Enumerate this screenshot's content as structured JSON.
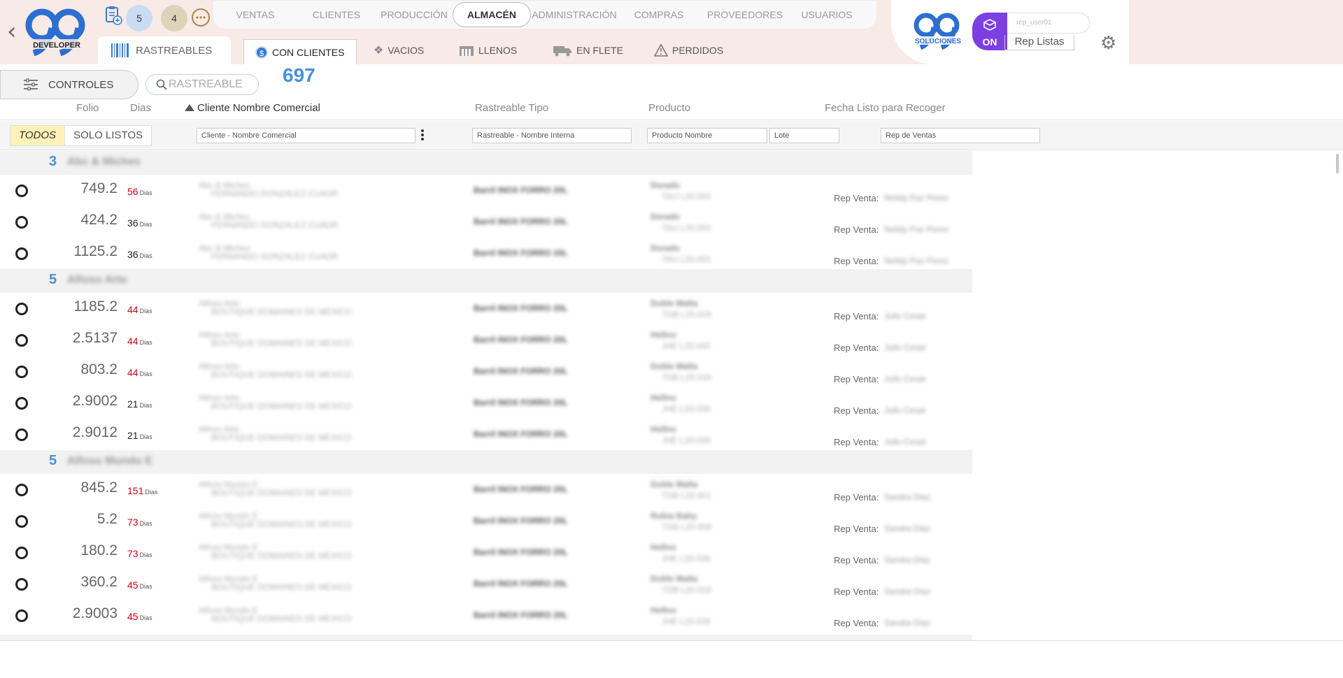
{
  "header": {
    "back_icon": "chevron-left-icon",
    "logo_left": {
      "main": "99",
      "caption": "DEVELOPER"
    },
    "badges": [
      {
        "value": "5",
        "color": "#c9dcf2"
      },
      {
        "value": "4",
        "color": "#ddd3b8"
      }
    ],
    "nav": [
      {
        "label": "VENTAS",
        "active": false
      },
      {
        "label": "CLIENTES",
        "active": false
      },
      {
        "label": "PRODUCCIÓN",
        "active": false
      },
      {
        "label": "ALMACÉN",
        "active": true
      },
      {
        "label": "ADMINISTRACIÓN",
        "active": false
      },
      {
        "label": "COMPRAS",
        "active": false
      },
      {
        "label": "PROVEEDORES",
        "active": false
      },
      {
        "label": "USUARIOS",
        "active": false
      }
    ],
    "logo_right": {
      "main": "99",
      "caption": "SOLUCIONES"
    },
    "on_label": "ON",
    "rep_input_value": "rep_user01",
    "rep_listas_label": "Rep Listas"
  },
  "subtabs": {
    "rastreables": "RASTREABLES",
    "con_clientes": "CON CLIENTES",
    "vacios": "VACIOS",
    "llenos": "LLENOS",
    "en_flete": "EN FLETE",
    "perdidos": "PERDIDOS"
  },
  "controls": {
    "controles_label": "CONTROLES",
    "search_placeholder": "RASTREABLE",
    "count": "697"
  },
  "columns": {
    "folio": "Folio",
    "dias": "Dias",
    "cliente": "Cliente Nombre Comercial",
    "tipo": "Rastreable Tipo",
    "producto": "Producto",
    "fecha": "Fecha Listo para Recoger"
  },
  "filters": {
    "todos": "TODOS",
    "solo_listos": "SOLO LISTOS",
    "cliente_placeholder": "Cliente - Nombre Comercial",
    "rastreable_placeholder": "Rastreable - Nombre Interna",
    "producto_placeholder": "Producto Nombre",
    "lote_placeholder": "Lote",
    "rep_placeholder": "Rep de Ventas"
  },
  "rep_label": "Rep Venta:",
  "dias_unit": "Dias",
  "groups": [
    {
      "count": "3",
      "name": "Abc & Miches",
      "rows": [
        {
          "folio": "749.2",
          "dias": "56",
          "red": true,
          "c1": "Abc & Miches",
          "c2": "FERNANDO GONZALEZ CUADR",
          "tipo": "Barril INOX FORRO 20L",
          "p1": "Dorado",
          "p2": "TAU L20.003",
          "rep": "Nelidy Paz Perez"
        },
        {
          "folio": "424.2",
          "dias": "36",
          "red": false,
          "c1": "Abc & Miches",
          "c2": "FERNANDO GONZALEZ CUADR",
          "tipo": "Barril INOX FORRO 20L",
          "p1": "Dorado",
          "p2": "TAU L20.003",
          "rep": "Nelidy Paz Perez"
        },
        {
          "folio": "1125.2",
          "dias": "36",
          "red": false,
          "c1": "Abc & Miches",
          "c2": "FERNANDO GONZALEZ CUADR",
          "tipo": "Barril INOX FORRO 20L",
          "p1": "Dorado",
          "p2": "TAU L20.003",
          "rep": "Nelidy Paz Perez"
        }
      ]
    },
    {
      "count": "5",
      "name": "Alfoso Arte",
      "rows": [
        {
          "folio": "1185.2",
          "dias": "44",
          "red": true,
          "c1": "Alfoso Arte",
          "c2": "BOUTIQUE DOMAINES DE MEXICO",
          "tipo": "Barril INOX FORRO 20L",
          "p1": "Doble Malta",
          "p2": "TDB L20.018",
          "rep": "Julio Cesar"
        },
        {
          "folio": "2.5137",
          "dias": "44",
          "red": true,
          "c1": "Alfoso Arte",
          "c2": "BOUTIQUE DOMAINES DE MEXICO",
          "tipo": "Barril INOX FORRO 20L",
          "p1": "Hellno",
          "p2": "JHE L20.045",
          "rep": "Julio Cesar"
        },
        {
          "folio": "803.2",
          "dias": "44",
          "red": true,
          "c1": "Alfoso Arte",
          "c2": "BOUTIQUE DOMAINES DE MEXICO",
          "tipo": "Barril INOX FORRO 20L",
          "p1": "Doble Malta",
          "p2": "TDB L20.018",
          "rep": "Julio Cesar"
        },
        {
          "folio": "2.9002",
          "dias": "21",
          "red": false,
          "c1": "Alfoso Arte",
          "c2": "BOUTIQUE DOMAINES DE MEXICO",
          "tipo": "Barril INOX FORRO 20L",
          "p1": "Hellno",
          "p2": "JHE L20.039",
          "rep": "Julio Cesar"
        },
        {
          "folio": "2.9012",
          "dias": "21",
          "red": false,
          "c1": "Alfoso Arte",
          "c2": "BOUTIQUE DOMAINES DE MEXICO",
          "tipo": "Barril INOX FORRO 20L",
          "p1": "Hellno",
          "p2": "JHE L20.039",
          "rep": "Julio Cesar"
        }
      ]
    },
    {
      "count": "5",
      "name": "Alfoso Mundo E",
      "rows": [
        {
          "folio": "845.2",
          "dias": "151",
          "red": true,
          "c1": "Alfoso Mundo E",
          "c2": "BOUTIQUE DOMAINES DE MEXICO",
          "tipo": "Barril INOX FORRO 20L",
          "p1": "Doble Malta",
          "p2": "TDB L20.001",
          "rep": "Sandra Diaz"
        },
        {
          "folio": "5.2",
          "dias": "73",
          "red": true,
          "c1": "Alfoso Mundo E",
          "c2": "BOUTIQUE DOMAINES DE MEXICO",
          "tipo": "Barril INOX FORRO 20L",
          "p1": "Rubia Baby",
          "p2": "TDB L20.009",
          "rep": "Sandra Diaz"
        },
        {
          "folio": "180.2",
          "dias": "73",
          "red": true,
          "c1": "Alfoso Mundo E",
          "c2": "BOUTIQUE DOMAINES DE MEXICO",
          "tipo": "Barril INOX FORRO 20L",
          "p1": "Hellno",
          "p2": "JHE L20.036",
          "rep": "Sandra Diaz"
        },
        {
          "folio": "360.2",
          "dias": "45",
          "red": true,
          "c1": "Alfoso Mundo E",
          "c2": "BOUTIQUE DOMAINES DE MEXICO",
          "tipo": "Barril INOX FORRO 20L",
          "p1": "Doble Malta",
          "p2": "TDB L20.018",
          "rep": "Sandra Diaz"
        },
        {
          "folio": "2.9003",
          "dias": "45",
          "red": true,
          "c1": "Alfoso Mundo E",
          "c2": "BOUTIQUE DOMAINES DE MEXICO",
          "tipo": "Barril INOX FORRO 20L",
          "p1": "Hellno",
          "p2": "JHE L20.039",
          "rep": "Sandra Diaz"
        }
      ]
    }
  ]
}
